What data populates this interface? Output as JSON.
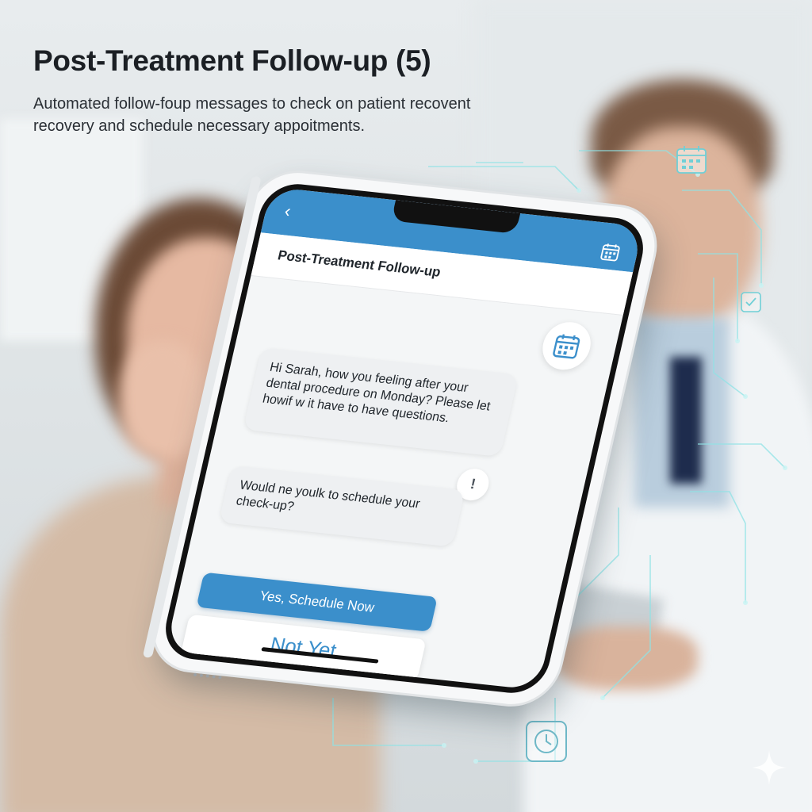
{
  "page": {
    "title": "Post-Treatment Follow-up (5)",
    "description": "Automated follow-foup messages to check on patient recovent recovery and schedule necessary appoitments."
  },
  "app": {
    "screen_title": "Post-Treatment Follow-up",
    "messages": [
      {
        "text": "Hi Sarah, how you feeling after your dental procedure on Monday? Please let howif w it have to have questions."
      },
      {
        "text": "Would ne youlk to schedule your check-up?"
      }
    ],
    "buttons": {
      "primary_label": "Yes, Schedule Now",
      "secondary_label": "Not Yet"
    }
  },
  "colors": {
    "accent": "#3b8fcb",
    "title_text": "#1b1f24",
    "bubble": "#eef0f2"
  },
  "icons": {
    "back": "chevron-left-icon",
    "calendar": "calendar-icon",
    "info": "alert-icon"
  }
}
